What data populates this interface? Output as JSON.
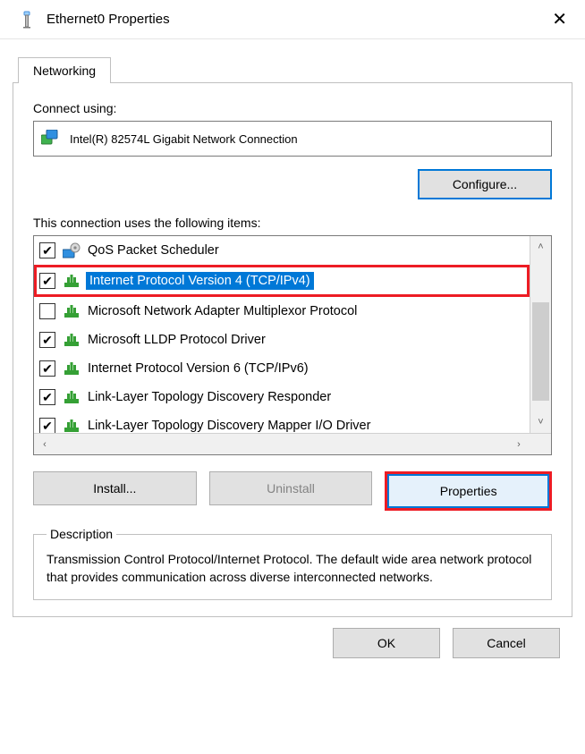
{
  "window": {
    "title": "Ethernet0 Properties",
    "close_glyph": "✕"
  },
  "tab": {
    "label": "Networking"
  },
  "connect_using_label": "Connect using:",
  "adapter": {
    "name": "Intel(R) 82574L Gigabit Network Connection"
  },
  "configure_label": "Configure...",
  "items_label": "This connection uses the following items:",
  "items": [
    {
      "checked": true,
      "icon": "gear",
      "label": "QoS Packet Scheduler",
      "selected": false
    },
    {
      "checked": true,
      "icon": "proto",
      "label": "Internet Protocol Version 4 (TCP/IPv4)",
      "selected": true,
      "callout": true
    },
    {
      "checked": false,
      "icon": "proto",
      "label": "Microsoft Network Adapter Multiplexor Protocol",
      "selected": false
    },
    {
      "checked": true,
      "icon": "proto",
      "label": "Microsoft LLDP Protocol Driver",
      "selected": false
    },
    {
      "checked": true,
      "icon": "proto",
      "label": "Internet Protocol Version 6 (TCP/IPv6)",
      "selected": false
    },
    {
      "checked": true,
      "icon": "proto",
      "label": "Link-Layer Topology Discovery Responder",
      "selected": false
    },
    {
      "checked": true,
      "icon": "proto",
      "label": "Link-Layer Topology Discovery Mapper I/O Driver",
      "selected": false
    }
  ],
  "buttons": {
    "install": "Install...",
    "uninstall": "Uninstall",
    "properties": "Properties"
  },
  "description": {
    "legend": "Description",
    "text": "Transmission Control Protocol/Internet Protocol. The default wide area network protocol that provides communication across diverse interconnected networks."
  },
  "footer": {
    "ok": "OK",
    "cancel": "Cancel"
  },
  "glyphs": {
    "check": "✔",
    "up": "˄",
    "down": "˅",
    "left": "‹",
    "right": "›"
  }
}
